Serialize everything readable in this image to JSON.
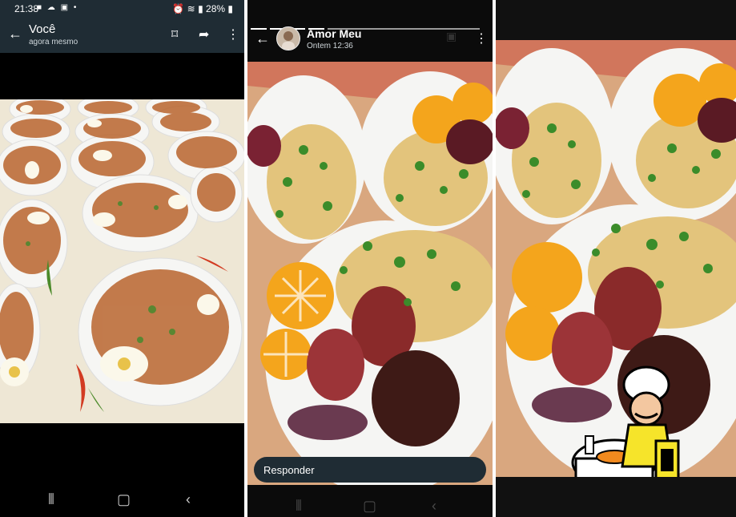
{
  "left": {
    "status": {
      "time": "21:38",
      "battery": "28%"
    },
    "appbar": {
      "title": "Você",
      "subtitle": "agora mesmo"
    }
  },
  "middle": {
    "appbar": {
      "title": "Amor Meu",
      "subtitle": "Ontem 12:36"
    },
    "reply": {
      "label": "Responder"
    }
  },
  "icons": {
    "back": "back-arrow-icon",
    "bookmark": "bookmark-icon",
    "share": "share-icon",
    "more": "more-vertical-icon"
  }
}
